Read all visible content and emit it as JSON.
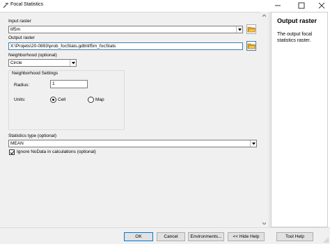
{
  "window": {
    "title": "Focal Statistics"
  },
  "form": {
    "input_raster": {
      "label": "Input raster",
      "value": "tif5m"
    },
    "output_raster": {
      "label": "Output raster",
      "value": "X:\\Projets\\20-0893\\prob_focStats.gdb\\tif5m_focStats"
    },
    "neighborhood": {
      "label": "Neighborhood (optional)",
      "value": "Circle"
    },
    "neighborhood_settings": {
      "title": "Neighborhood Settings",
      "radius_label": "Radius:",
      "radius_value": "1",
      "units_label": "Units:",
      "units_options": [
        {
          "label": "Cell",
          "selected": true
        },
        {
          "label": "Map",
          "selected": false
        }
      ]
    },
    "statistics_type": {
      "label": "Statistics type (optional)",
      "value": "MEAN"
    },
    "ignore_nodata": {
      "label": "Ignore NoData in calculations (optional)",
      "checked": true
    }
  },
  "help": {
    "title": "Output raster",
    "body": "The output focal statistics raster."
  },
  "buttons": {
    "ok": "OK",
    "cancel": "Cancel",
    "environments": "Environments...",
    "hide_help": "<< Hide Help",
    "tool_help": "Tool Help"
  },
  "colors": {
    "focus_border": "#3c7fb1",
    "default_button_border": "#0078d7",
    "folder_icon": "#e8a31b"
  }
}
